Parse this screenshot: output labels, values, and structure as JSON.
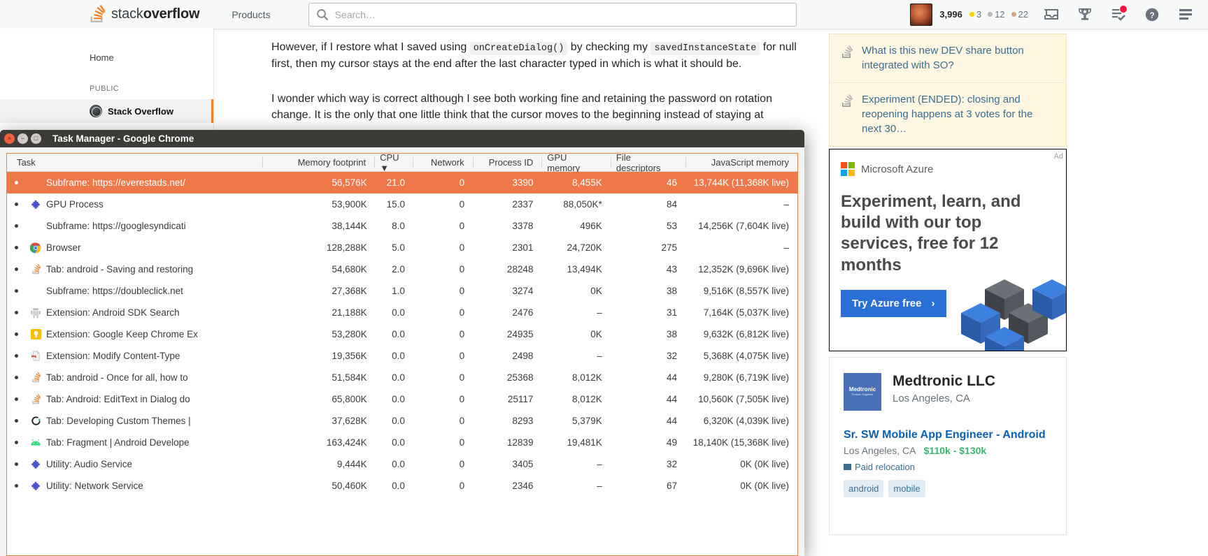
{
  "so_header": {
    "logo_text_light": "stack",
    "logo_text_bold": "overflow",
    "products_label": "Products",
    "search_placeholder": "Search…",
    "reputation": "3,996",
    "gold_badges": "3",
    "silver_badges": "12",
    "bronze_badges": "22",
    "icons": [
      "inbox-icon",
      "trophy-icon",
      "review-icon",
      "help-icon",
      "hamburger-icon"
    ]
  },
  "so_sidebar": {
    "home_label": "Home",
    "public_header": "PUBLIC",
    "stack_overflow_label": "Stack Overflow"
  },
  "so_post": {
    "p1_a": "However, if I restore what I saved using ",
    "p1_code1": "onCreateDialog()",
    "p1_b": " by checking my ",
    "p1_code2": "savedInstanceState",
    "p1_c": " for null first, then my cursor stays at the end after the last character typed in which is what it should be.",
    "p2": "I wonder which way is correct although I see both working fine and retaining the password on rotation change. It is the only that one little think that the cursor moves to the beginning instead of staying at"
  },
  "so_rail": {
    "items": [
      {
        "text": "What is this new DEV share button integrated with SO?"
      },
      {
        "text": "Experiment (ENDED): closing and reopening happens at 3 votes for the next 30…"
      }
    ]
  },
  "azure_ad": {
    "brand": "Microsoft Azure",
    "headline": "Experiment, learn, and build with our top services, free for 12 months",
    "cta": "Try Azure free",
    "cta_arrow": "›",
    "ad_mark": "Ad",
    "colors": {
      "button": "#2a6fd6",
      "ms_red": "#f25022",
      "ms_green": "#7fba00",
      "ms_blue": "#00a4ef",
      "ms_yellow": "#ffb900"
    }
  },
  "job_card": {
    "logo_text": "Medtronic",
    "logo_tagline": "Further, Together",
    "company": "Medtronic LLC",
    "company_location": "Los Angeles, CA",
    "title": "Sr. SW Mobile App Engineer - Android",
    "location": "Los Angeles, CA",
    "salary": "$110k - $130k",
    "relocation": "Paid relocation",
    "tags": [
      "android",
      "mobile"
    ]
  },
  "taskmgr": {
    "window_title": "Task Manager - Google Chrome",
    "window_buttons": [
      "close-button",
      "minimize-button",
      "maximize-button"
    ],
    "sort_indicator": "▼",
    "columns": [
      {
        "key": "task",
        "label": "Task"
      },
      {
        "key": "memory",
        "label": "Memory footprint"
      },
      {
        "key": "cpu",
        "label": "CPU ▼"
      },
      {
        "key": "network",
        "label": "Network"
      },
      {
        "key": "pid",
        "label": "Process ID"
      },
      {
        "key": "gpu",
        "label": "GPU memory"
      },
      {
        "key": "fd",
        "label": "File descriptors"
      },
      {
        "key": "js",
        "label": "JavaScript memory"
      }
    ],
    "rows": [
      {
        "icon": "none",
        "task": "Subframe: https://everestads.net/",
        "memory": "56,576K",
        "cpu": "21.0",
        "network": "0",
        "pid": "3390",
        "gpu": "8,455K",
        "fd": "46",
        "js": "13,744K (11,368K live)",
        "selected": true
      },
      {
        "icon": "puzzle-icon",
        "task": "GPU Process",
        "memory": "53,900K",
        "cpu": "15.0",
        "network": "0",
        "pid": "2337",
        "gpu": "88,050K*",
        "fd": "84",
        "js": "–",
        "selected": false
      },
      {
        "icon": "none",
        "task": "Subframe: https://googlesyndicati",
        "memory": "38,144K",
        "cpu": "8.0",
        "network": "0",
        "pid": "3378",
        "gpu": "496K",
        "fd": "53",
        "js": "14,256K (7,604K live)",
        "selected": false
      },
      {
        "icon": "chrome-icon",
        "task": "Browser",
        "memory": "128,288K",
        "cpu": "5.0",
        "network": "0",
        "pid": "2301",
        "gpu": "24,720K",
        "fd": "275",
        "js": "–",
        "selected": false
      },
      {
        "icon": "stackoverflow-icon",
        "task": "Tab: android - Saving and restoring",
        "memory": "54,680K",
        "cpu": "2.0",
        "network": "0",
        "pid": "28248",
        "gpu": "13,494K",
        "fd": "43",
        "js": "12,352K (9,696K live)",
        "selected": false
      },
      {
        "icon": "none",
        "task": "Subframe: https://doubleclick.net",
        "memory": "27,368K",
        "cpu": "1.0",
        "network": "0",
        "pid": "3274",
        "gpu": "0K",
        "fd": "38",
        "js": "9,516K (8,557K live)",
        "selected": false
      },
      {
        "icon": "androidsdk-icon",
        "task": "Extension: Android SDK Search",
        "memory": "21,188K",
        "cpu": "0.0",
        "network": "0",
        "pid": "2476",
        "gpu": "–",
        "fd": "31",
        "js": "7,164K (5,037K live)",
        "selected": false
      },
      {
        "icon": "keep-icon",
        "task": "Extension: Google Keep Chrome Ex",
        "memory": "53,280K",
        "cpu": "0.0",
        "network": "0",
        "pid": "24935",
        "gpu": "0K",
        "fd": "38",
        "js": "9,632K (6,812K live)",
        "selected": false
      },
      {
        "icon": "modifycontent-icon",
        "task": "Extension: Modify Content-Type",
        "memory": "19,356K",
        "cpu": "0.0",
        "network": "0",
        "pid": "2498",
        "gpu": "–",
        "fd": "32",
        "js": "5,368K (4,075K live)",
        "selected": false
      },
      {
        "icon": "stackoverflow-icon",
        "task": "Tab: android - Once for all, how to",
        "memory": "51,584K",
        "cpu": "0.0",
        "network": "0",
        "pid": "25368",
        "gpu": "8,012K",
        "fd": "44",
        "js": "9,280K (6,719K live)",
        "selected": false
      },
      {
        "icon": "stackoverflow-icon",
        "task": "Tab: Android: EditText in Dialog do",
        "memory": "65,800K",
        "cpu": "0.0",
        "network": "0",
        "pid": "25117",
        "gpu": "8,012K",
        "fd": "44",
        "js": "10,560K (7,505K live)",
        "selected": false
      },
      {
        "icon": "codepen-icon",
        "task": "Tab: Developing Custom Themes | ",
        "memory": "37,628K",
        "cpu": "0.0",
        "network": "0",
        "pid": "8293",
        "gpu": "5,379K",
        "fd": "44",
        "js": "6,320K (4,039K live)",
        "selected": false
      },
      {
        "icon": "android-icon",
        "task": "Tab: Fragment | Android Develope",
        "memory": "163,424K",
        "cpu": "0.0",
        "network": "0",
        "pid": "12839",
        "gpu": "19,481K",
        "fd": "49",
        "js": "18,140K (15,368K live)",
        "selected": false
      },
      {
        "icon": "puzzle-icon",
        "task": "Utility: Audio Service",
        "memory": "9,444K",
        "cpu": "0.0",
        "network": "0",
        "pid": "3405",
        "gpu": "–",
        "fd": "32",
        "js": "0K (0K live)",
        "selected": false
      },
      {
        "icon": "puzzle-icon",
        "task": "Utility: Network Service",
        "memory": "50,460K",
        "cpu": "0.0",
        "network": "0",
        "pid": "2346",
        "gpu": "–",
        "fd": "67",
        "js": "0K (0K live)",
        "selected": false
      }
    ]
  }
}
